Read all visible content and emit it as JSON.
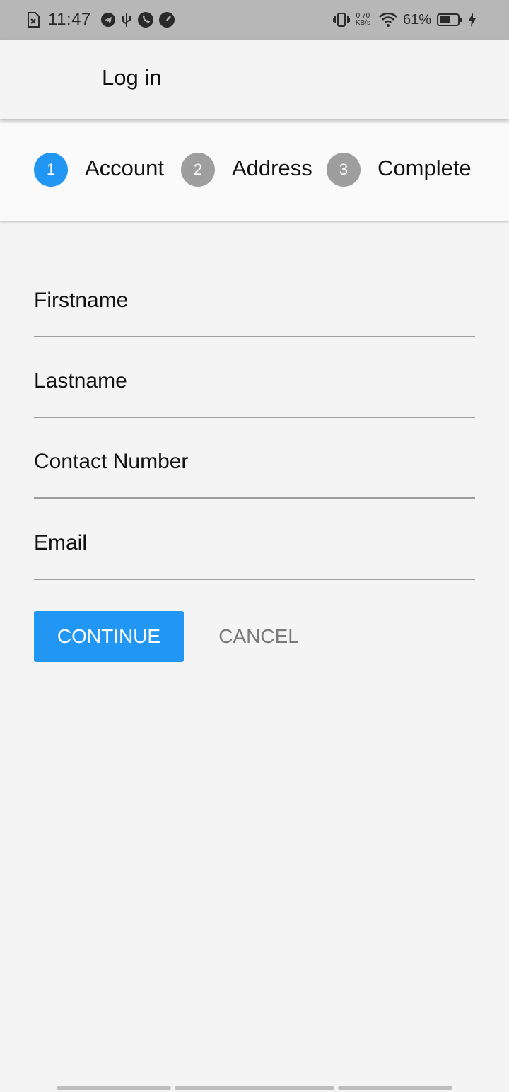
{
  "status_bar": {
    "time": "11:47",
    "net_speed_value": "0.70",
    "net_speed_unit": "KB/s",
    "battery_percent": "61%",
    "icons": [
      "sim-error-icon",
      "telegram-icon",
      "usb-icon",
      "phone-icon",
      "speedometer-icon",
      "vibrate-icon",
      "wifi-icon",
      "battery-icon",
      "charging-icon"
    ]
  },
  "app_bar": {
    "title": "Log in"
  },
  "stepper": {
    "steps": [
      {
        "number": "1",
        "label": "Account",
        "state": "active",
        "color": "#2196f3"
      },
      {
        "number": "2",
        "label": "Address",
        "state": "inactive",
        "color": "#9e9e9e"
      },
      {
        "number": "3",
        "label": "Complete",
        "state": "inactive",
        "color": "#9e9e9e"
      }
    ]
  },
  "form": {
    "fields": [
      {
        "placeholder": "Firstname",
        "value": ""
      },
      {
        "placeholder": "Lastname",
        "value": ""
      },
      {
        "placeholder": "Contact Number",
        "value": ""
      },
      {
        "placeholder": "Email",
        "value": ""
      }
    ]
  },
  "actions": {
    "continue_label": "CONTINUE",
    "cancel_label": "CANCEL",
    "accent_color": "#2196f3"
  }
}
